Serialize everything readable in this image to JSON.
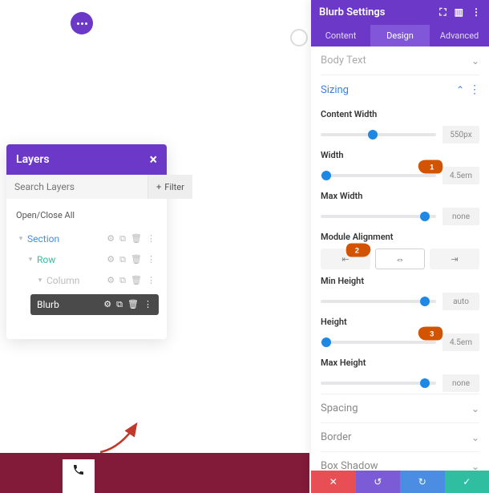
{
  "fab": {
    "name": "more-menu"
  },
  "layers": {
    "title": "Layers",
    "search_placeholder": "Search Layers",
    "filter_label": "Filter",
    "open_close_label": "Open/Close All",
    "tree": {
      "section": "Section",
      "row": "Row",
      "column": "Column",
      "blurb": "Blurb"
    }
  },
  "settings": {
    "title": "Blurb Settings",
    "tabs": {
      "content": "Content",
      "design": "Design",
      "advanced": "Advanced"
    },
    "sections": {
      "body_text": "Body Text",
      "sizing": "Sizing",
      "spacing": "Spacing",
      "border": "Border",
      "box_shadow": "Box Shadow"
    },
    "sizing": {
      "content_width": {
        "label": "Content Width",
        "value": "550px",
        "pos": 45
      },
      "width": {
        "label": "Width",
        "value": "4.5em",
        "pos": 5
      },
      "max_width": {
        "label": "Max Width",
        "value": "none",
        "pos": 90
      },
      "module_align": {
        "label": "Module Alignment"
      },
      "min_height": {
        "label": "Min Height",
        "value": "auto",
        "pos": 90
      },
      "height": {
        "label": "Height",
        "value": "4.5em",
        "pos": 5
      },
      "max_height": {
        "label": "Max Height",
        "value": "none",
        "pos": 90
      }
    }
  },
  "callouts": {
    "one": "1",
    "two": "2",
    "three": "3"
  },
  "colors": {
    "purple": "#6b38c7",
    "blue": "#1e88e5",
    "maroon": "#821a3a",
    "red": "#e84f54",
    "teal": "#2fbfa0"
  }
}
